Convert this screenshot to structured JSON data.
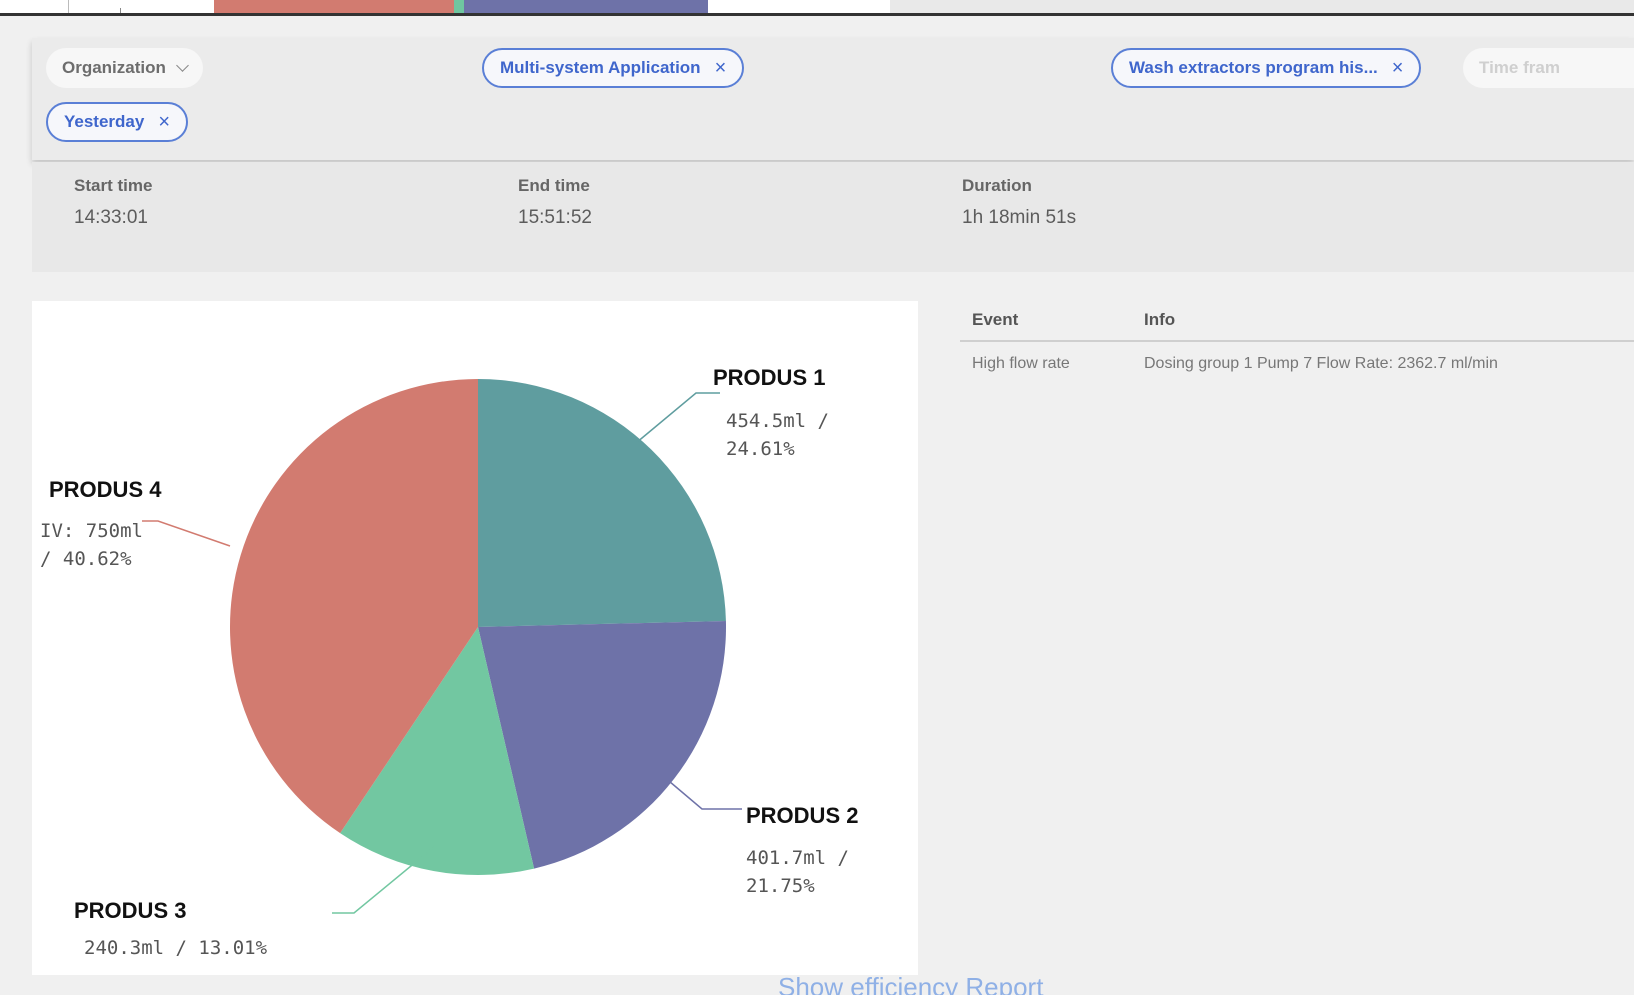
{
  "filters": {
    "organization": "Organization",
    "application": "Multi-system Application",
    "program": "Wash extractors program his...",
    "timeframe": "Time fram",
    "period": "Yesterday",
    "remove_glyph": "×"
  },
  "timing": {
    "start_label": "Start time",
    "start_value": "14:33:01",
    "end_label": "End time",
    "end_value": "15:51:52",
    "duration_label": "Duration",
    "duration_value": "1h 18min 51s"
  },
  "chart_data": {
    "type": "pie",
    "slices": [
      {
        "name": "PRODUS 1",
        "value": 454.5,
        "unit": "ml",
        "percent": 24.61,
        "label_line1": "454.5ml /",
        "label_line2": "24.61%",
        "color": "#5f9d9f"
      },
      {
        "name": "PRODUS 2",
        "value": 401.7,
        "unit": "ml",
        "percent": 21.75,
        "label_line1": "401.7ml /",
        "label_line2": "21.75%",
        "color": "#6e72a8"
      },
      {
        "name": "PRODUS 3",
        "value": 240.3,
        "unit": "ml",
        "percent": 13.01,
        "label_line1": "240.3ml / 13.01%",
        "label_line2": "",
        "color": "#72c7a1"
      },
      {
        "name": "PRODUS 4",
        "value": 750,
        "unit": "ml",
        "percent": 40.62,
        "label_line1": "IV: 750ml",
        "label_line2": "/ 40.62%",
        "color": "#d27b70"
      }
    ]
  },
  "events": {
    "columns": [
      "Event",
      "Info"
    ],
    "rows": [
      {
        "event": "High flow rate",
        "info": "Dosing group 1 Pump 7 Flow Rate: 2362.7 ml/min"
      }
    ]
  },
  "report_link": "Show efficiency Report"
}
